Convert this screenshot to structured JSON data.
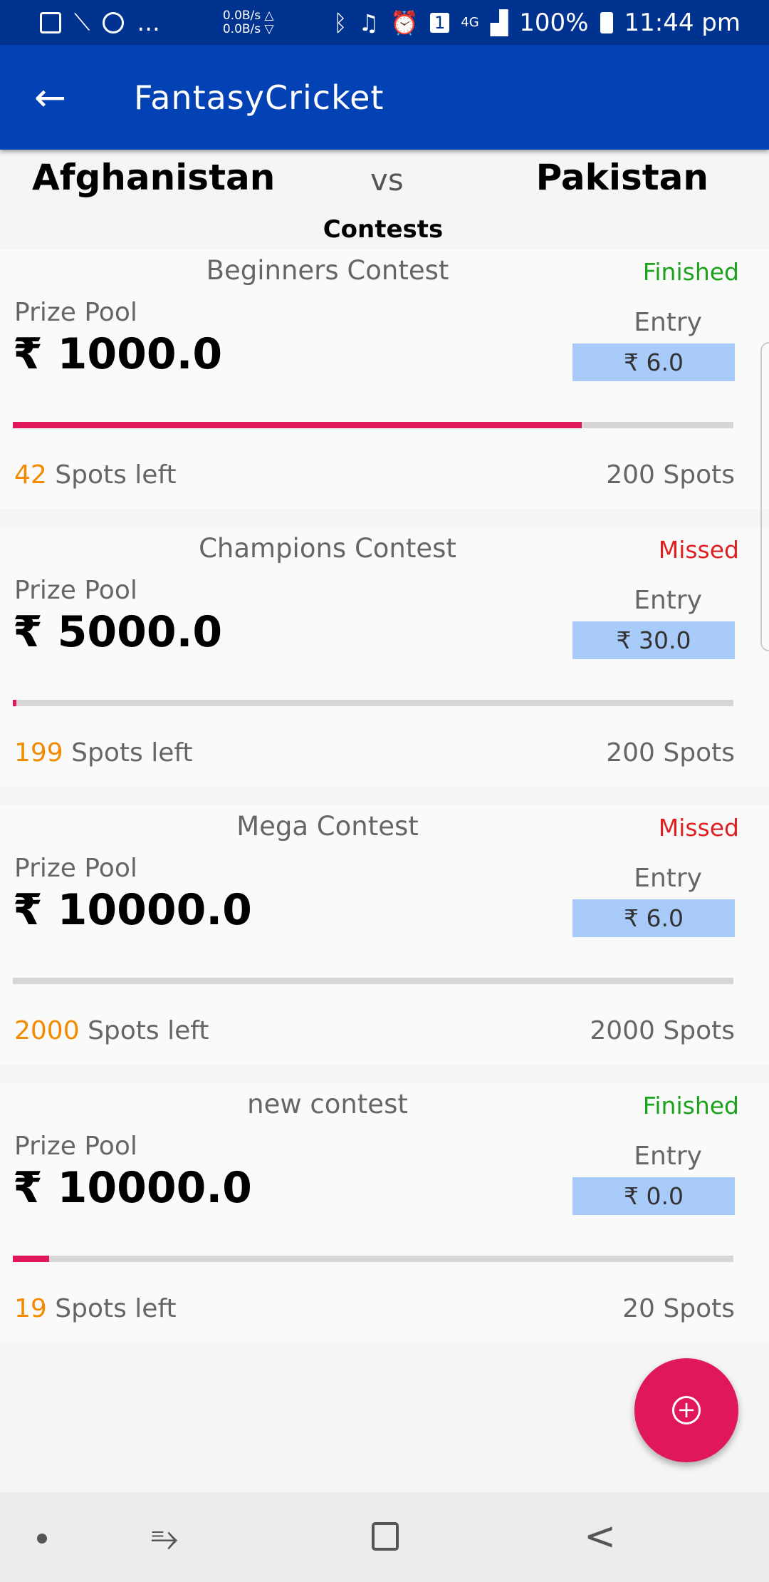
{
  "status_bar": {
    "speed_up": "0.0B/s △",
    "speed_down": "0.0B/s ▽",
    "ellipsis": "...",
    "notification_count": "1",
    "network": "4G",
    "battery": "100%",
    "time": "11:44 pm"
  },
  "app_bar": {
    "title": "FantasyCricket"
  },
  "match": {
    "team_a": "Afghanistan",
    "vs": "vs",
    "team_b": "Pakistan",
    "section_title": "Contests"
  },
  "contests": [
    {
      "name": "Beginners Contest",
      "status": "Finished",
      "status_color": "#1aa21a",
      "prize_label": "Prize Pool",
      "prize": "₹ 1000.0",
      "entry_label": "Entry",
      "entry_fee": "₹ 6.0",
      "spots_left": "42",
      "spots_left_label": "Spots left",
      "total_spots": "200 Spots",
      "filled_fraction": 0.79
    },
    {
      "name": "Champions Contest",
      "status": "Missed",
      "status_color": "#e02020",
      "prize_label": "Prize Pool",
      "prize": "₹ 5000.0",
      "entry_label": "Entry",
      "entry_fee": "₹ 30.0",
      "spots_left": "199",
      "spots_left_label": "Spots left",
      "total_spots": "200 Spots",
      "filled_fraction": 0.005
    },
    {
      "name": "Mega Contest",
      "status": "Missed",
      "status_color": "#e02020",
      "prize_label": "Prize Pool",
      "prize": "₹ 10000.0",
      "entry_label": "Entry",
      "entry_fee": "₹ 6.0",
      "spots_left": "2000",
      "spots_left_label": "Spots left",
      "total_spots": "2000 Spots",
      "filled_fraction": 0
    },
    {
      "name": "new contest",
      "status": "Finished",
      "status_color": "#1aa21a",
      "prize_label": "Prize Pool",
      "prize": "₹ 10000.0",
      "entry_label": "Entry",
      "entry_fee": "₹ 0.0",
      "spots_left": "19",
      "spots_left_label": "Spots left",
      "total_spots": "20 Spots",
      "filled_fraction": 0.05
    }
  ],
  "fab": {
    "icon": "add-circle-icon"
  },
  "nav_bar": {
    "icons": [
      "nav-dot-icon",
      "recent-apps-icon",
      "home-icon",
      "back-icon"
    ]
  }
}
